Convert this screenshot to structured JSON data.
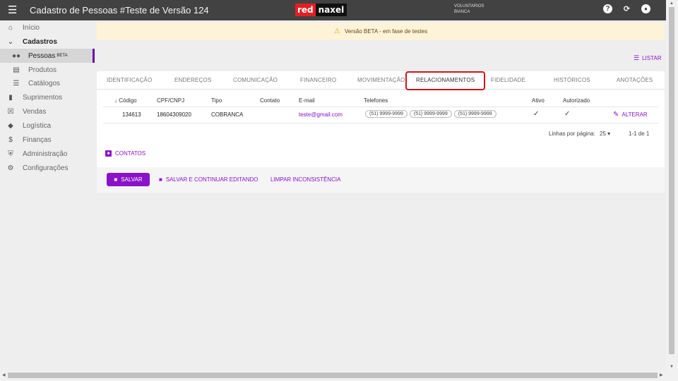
{
  "topbar": {
    "title": "Cadastro de Pessoas #Teste de Versão 124",
    "logo_red": "red",
    "logo_dark": "naxel",
    "org_line1": "VOLUNTARIOS",
    "org_line2": "BIANCA",
    "icons": [
      "menu-icon",
      "help-icon",
      "refresh-icon",
      "account-icon"
    ]
  },
  "sidebar": {
    "items": [
      {
        "label": "Início",
        "icon": "home-icon"
      },
      {
        "label": "Cadastros",
        "icon": "chevron-down-icon"
      },
      {
        "label": "Pessoas",
        "badge": "BETA",
        "icon": "people-icon"
      },
      {
        "label": "Produtos",
        "icon": "book-icon"
      },
      {
        "label": "Catálogos",
        "icon": "list-icon"
      },
      {
        "label": "Suprimentos",
        "icon": "inventory-icon"
      },
      {
        "label": "Vendas",
        "icon": "cart-icon"
      },
      {
        "label": "Logística",
        "icon": "diamond-icon"
      },
      {
        "label": "Finanças",
        "icon": "money-icon"
      },
      {
        "label": "Administração",
        "icon": "shield-icon"
      },
      {
        "label": "Configurações",
        "icon": "gear-icon"
      }
    ]
  },
  "banner": {
    "text": "Versão BETA - em fase de testes"
  },
  "listar": {
    "label": "LISTAR"
  },
  "tabs": [
    {
      "label": "IDENTIFICAÇÃO"
    },
    {
      "label": "ENDEREÇOS"
    },
    {
      "label": "COMUNICAÇÃO"
    },
    {
      "label": "FINANCEIRO"
    },
    {
      "label": "MOVIMENTAÇÃO"
    },
    {
      "label": "RELACIONAMENTOS"
    },
    {
      "label": "FIDELIDADE"
    },
    {
      "label": "HISTÓRICOS"
    },
    {
      "label": "ANOTAÇÕES"
    }
  ],
  "active_tab": "RELACIONAMENTOS",
  "table": {
    "headers": {
      "codigo": "Código",
      "cpf": "CPF/CNPJ",
      "tipo": "Tipo",
      "contato": "Contato",
      "email": "E-mail",
      "telefones": "Telefones",
      "ativo": "Ativo",
      "autorizado": "Autorizado"
    },
    "rows": [
      {
        "codigo": "134613",
        "cpf": "18604309020",
        "tipo": "COBRANCA",
        "contato": "",
        "email": "teste@gmail.com",
        "telefones": [
          "(51) 9999-9999",
          "(51) 9999-9999",
          "(51) 9999-9999"
        ],
        "ativo": "✓",
        "autorizado": "✓",
        "action": "ALTERAR"
      }
    ],
    "pagination": {
      "rows_label": "Linhas por página:",
      "rows_value": "25",
      "range": "1-1 de 1"
    }
  },
  "contatos_label": "CONTATOS",
  "actions": {
    "save": "SALVAR",
    "save_continue": "SALVAR E CONTINUAR EDITANDO",
    "clear": "LIMPAR INCONSISTÊNCIA"
  }
}
